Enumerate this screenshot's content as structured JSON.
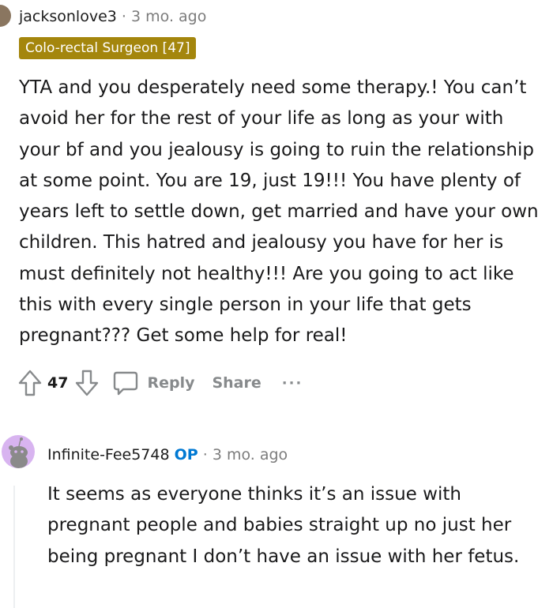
{
  "comment1": {
    "author": "jacksonlove3",
    "separator": "·",
    "time": "3 mo. ago",
    "flair": "Colo-rectal Surgeon [47]",
    "body": "YTA and you desperately need some therapy.! You can’t avoid her for the rest of your life as long as your with your bf and you jealousy is going to ruin the relationship at some point. You are 19, just 19!!! You have plenty of years left to settle down, get married and have your own children. This hatred and jealousy you have for her is must definitely not healthy!!! Are you going to act like this with every single person in your life that gets pregnant??? Get some help for real!",
    "score": "47",
    "reply_label": "Reply",
    "share_label": "Share",
    "more_label": "···",
    "avatar_color": "#8a7660",
    "flair_color": "#a4860d"
  },
  "comment2": {
    "author": "Infinite-Fee5748",
    "op_badge": "OP",
    "separator": "·",
    "time": "3 mo. ago",
    "body": "It seems as everyone thinks it’s an issue with pregnant people and babies straight up no just her being pregnant I don’t have an issue with her fetus.",
    "avatar_color": "#d8b4f0",
    "op_color": "#0079d3"
  }
}
